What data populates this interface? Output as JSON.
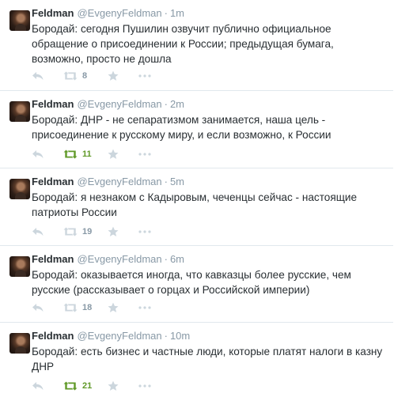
{
  "tweets": [
    {
      "name": "Feldman",
      "handle": "@EvgenyFeldman",
      "separator": "·",
      "time": "1m",
      "text": "Бородай: сегодня Пушилин озвучит публично официальное обращение о присоединении к России; предыдущая бумага, возможно, просто не дошла",
      "retweets": "8",
      "retweeted": false
    },
    {
      "name": "Feldman",
      "handle": "@EvgenyFeldman",
      "separator": "·",
      "time": "2m",
      "text": "Бородай: ДНР - не сепаратизмом занимается, наша цель - присоединение к русскому миру, и если возможно, к России",
      "retweets": "11",
      "retweeted": true
    },
    {
      "name": "Feldman",
      "handle": "@EvgenyFeldman",
      "separator": "·",
      "time": "5m",
      "text": "Бородай: я незнаком с Кадыровым, чеченцы сейчас - настоящие патриоты России",
      "retweets": "19",
      "retweeted": false
    },
    {
      "name": "Feldman",
      "handle": "@EvgenyFeldman",
      "separator": "·",
      "time": "6m",
      "text": "Бородай: оказывается иногда, что кавказцы более русские, чем русские (рассказывает о горцах и Российской империи)",
      "retweets": "18",
      "retweeted": false
    },
    {
      "name": "Feldman",
      "handle": "@EvgenyFeldman",
      "separator": "·",
      "time": "10m",
      "text": "Бородай: есть бизнес и частные люди, которые платят налоги в казну ДНР",
      "retweets": "21",
      "retweeted": true
    }
  ],
  "colors": {
    "text": "#292f33",
    "meta": "#8899a6",
    "icon": "#ccd6dd",
    "retweet_active": "#609928",
    "divider": "#e1e8ed"
  },
  "icons": {
    "reply": "reply-icon",
    "retweet": "retweet-icon",
    "favorite": "star-icon",
    "more": "more-dots-icon",
    "avatar": "avatar"
  }
}
